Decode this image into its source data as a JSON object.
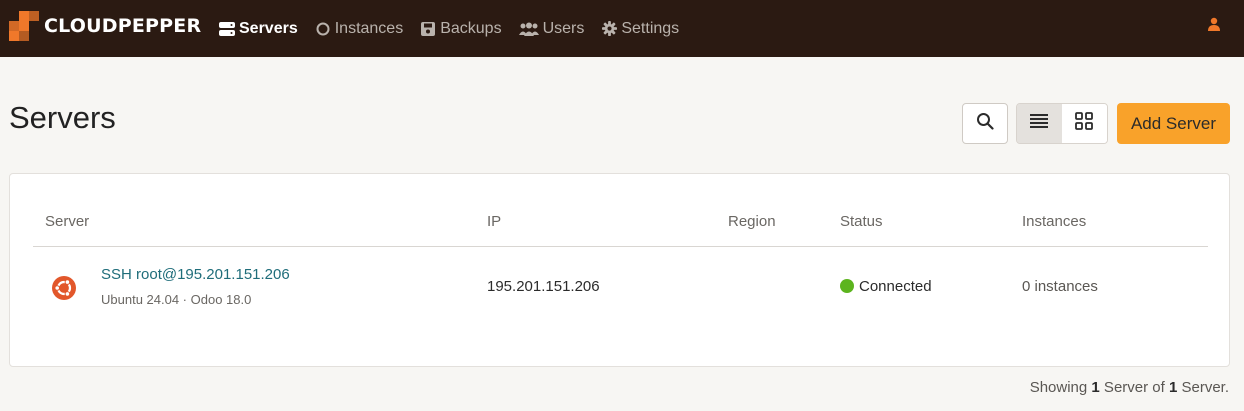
{
  "brand": {
    "name": "CLOUDPEPPER",
    "accent": "#f0782a"
  },
  "nav": {
    "items": [
      {
        "label": "Servers",
        "icon": "server-icon",
        "active": true
      },
      {
        "label": "Instances",
        "icon": "circle-icon",
        "active": false
      },
      {
        "label": "Backups",
        "icon": "save-icon",
        "active": false
      },
      {
        "label": "Users",
        "icon": "users-icon",
        "active": false
      },
      {
        "label": "Settings",
        "icon": "gear-icon",
        "active": false
      }
    ],
    "user_icon": "user-icon"
  },
  "page": {
    "title": "Servers",
    "add_button": "Add Server",
    "add_button_color": "#f9a22a"
  },
  "table": {
    "columns": [
      "Server",
      "IP",
      "Region",
      "Status",
      "Instances"
    ],
    "rows": [
      {
        "os_icon": "ubuntu-icon",
        "server": "SSH root@195.201.151.206",
        "subtitle": "Ubuntu 24.04 · Odoo 18.0",
        "ip": "195.201.151.206",
        "region": "",
        "status": "Connected",
        "status_color": "#5cb41e",
        "instances": "0 instances"
      }
    ]
  },
  "footer": {
    "prefix": "Showing ",
    "shown": "1",
    "middle": " Server of ",
    "total": "1",
    "suffix": " Server."
  }
}
